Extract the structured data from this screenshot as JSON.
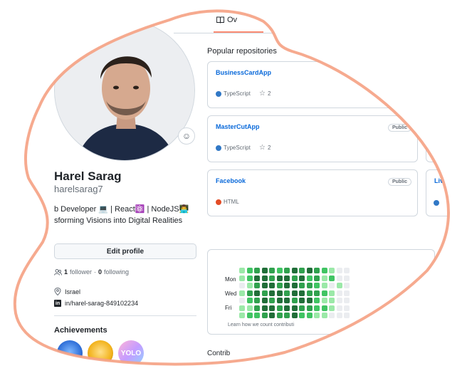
{
  "profile": {
    "name": "Harel Sarag",
    "login": "harelsarag7",
    "bio_line1": "b Developer 💻 | React⚛️ | NodeJS👨‍💻",
    "bio_line2": "sforming Visions into Digital Realities",
    "edit_label": "Edit profile",
    "followers_count": "1",
    "followers_label": "follower",
    "following_count": "0",
    "following_label": "following",
    "separator": "·",
    "location": "Israel",
    "linkedin": "in/harel-sarag-849102234",
    "achievements_title": "Achievements",
    "badge_yolo": "YOLO"
  },
  "tabs": {
    "overview_label": "Ov"
  },
  "popular": {
    "title": "Popular repositories",
    "repos": [
      {
        "name": "BusinessCardApp",
        "visibility": "",
        "language": "TypeScript",
        "language_color": "#3178c6",
        "stars": "2"
      },
      {
        "name": "MasterCutApp",
        "visibility": "Public",
        "language": "TypeScript",
        "language_color": "#3178c6",
        "stars": "2"
      },
      {
        "name": "Facebook",
        "visibility": "Public",
        "language": "HTML",
        "language_color": "#e34c26",
        "stars": ""
      },
      {
        "name": "Liv",
        "visibility": "",
        "language": "",
        "language_color": "#3178c6",
        "stars": ""
      }
    ]
  },
  "contributions": {
    "days": [
      "Mon",
      "Wed",
      "Fri"
    ],
    "learn_link": "Learn how we count contributi",
    "section_title": "Contrib",
    "colors": [
      "#ebedf0",
      "#9be9a8",
      "#40c463",
      "#30a14e",
      "#216e39"
    ],
    "levels": [
      [
        1,
        2,
        3,
        4,
        3,
        2,
        3,
        4,
        3,
        4,
        3,
        2,
        1,
        0,
        0
      ],
      [
        1,
        2,
        4,
        4,
        3,
        4,
        4,
        3,
        4,
        2,
        3,
        1,
        2,
        0,
        0
      ],
      [
        0,
        1,
        3,
        4,
        4,
        3,
        4,
        4,
        3,
        3,
        2,
        1,
        0,
        1,
        0
      ],
      [
        1,
        3,
        4,
        3,
        4,
        4,
        3,
        4,
        4,
        3,
        3,
        2,
        1,
        0,
        0
      ],
      [
        0,
        2,
        3,
        4,
        3,
        4,
        4,
        3,
        4,
        4,
        2,
        1,
        1,
        0,
        0
      ],
      [
        1,
        1,
        3,
        4,
        4,
        3,
        4,
        4,
        3,
        3,
        2,
        2,
        1,
        0,
        0
      ],
      [
        1,
        2,
        2,
        3,
        4,
        3,
        3,
        4,
        2,
        2,
        1,
        1,
        0,
        0,
        0
      ]
    ]
  }
}
